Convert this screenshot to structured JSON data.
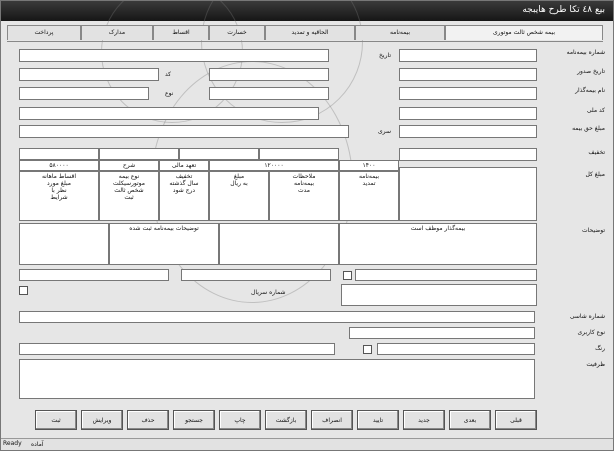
{
  "window": {
    "title": "بيع ٤٨ تكا طرح هايبجه"
  },
  "tabs": [
    "بیمه شخص ثالث موتوری",
    "بیمه‌نامه",
    "الحاقیه و تمدید",
    "خسارت",
    "اقساط",
    "مدارک",
    "پرداخت"
  ],
  "right_labels": [
    "شماره بیمه‌نامه",
    "تاریخ صدور",
    "نام بیمه‌گذار",
    "کد ملی",
    "مبلغ حق بیمه",
    "تخفیف",
    "مبلغ کل",
    "توضیحات"
  ],
  "center_labels": {
    "l1": "تاریخ",
    "l2": "کد",
    "l3": "نوع",
    "l4": "سری"
  },
  "table_row": [
    "۵۸۰۰۰۰",
    "شرح",
    "تعهد مالی",
    "۱۲۰۰۰۰",
    "۱۴۰۰"
  ],
  "info_cells": [
    "اقساط ماهانه\nمبلغ مورد\nنظر با\nشرایط",
    "نوع بیمه\nموتورسیکلت\nشخص ثالث\nثبت",
    "تخفیف\nسال گذشته\nدرج شود",
    "مبلغ\nبه ریال",
    "ملاحظات\nبیمه‌نامه\nمدت",
    "بیمه‌نامه\nتمدید"
  ],
  "notes": [
    "توضیحات بیمه‌نامه ثبت شده",
    "بیمه‌گذار موظف است",
    "شماره سریال"
  ],
  "bottom_labels": [
    "شماره شاسی",
    "نوع کاربری",
    "رنگ",
    "ظرفیت"
  ],
  "buttons": [
    "ثبت",
    "ویرایش",
    "حذف",
    "جستجو",
    "چاپ",
    "بازگشت",
    "انصراف",
    "تایید",
    "جدید",
    "بعدی",
    "قبلی"
  ],
  "status": {
    "text": "آماده",
    "caption": "Ready"
  }
}
